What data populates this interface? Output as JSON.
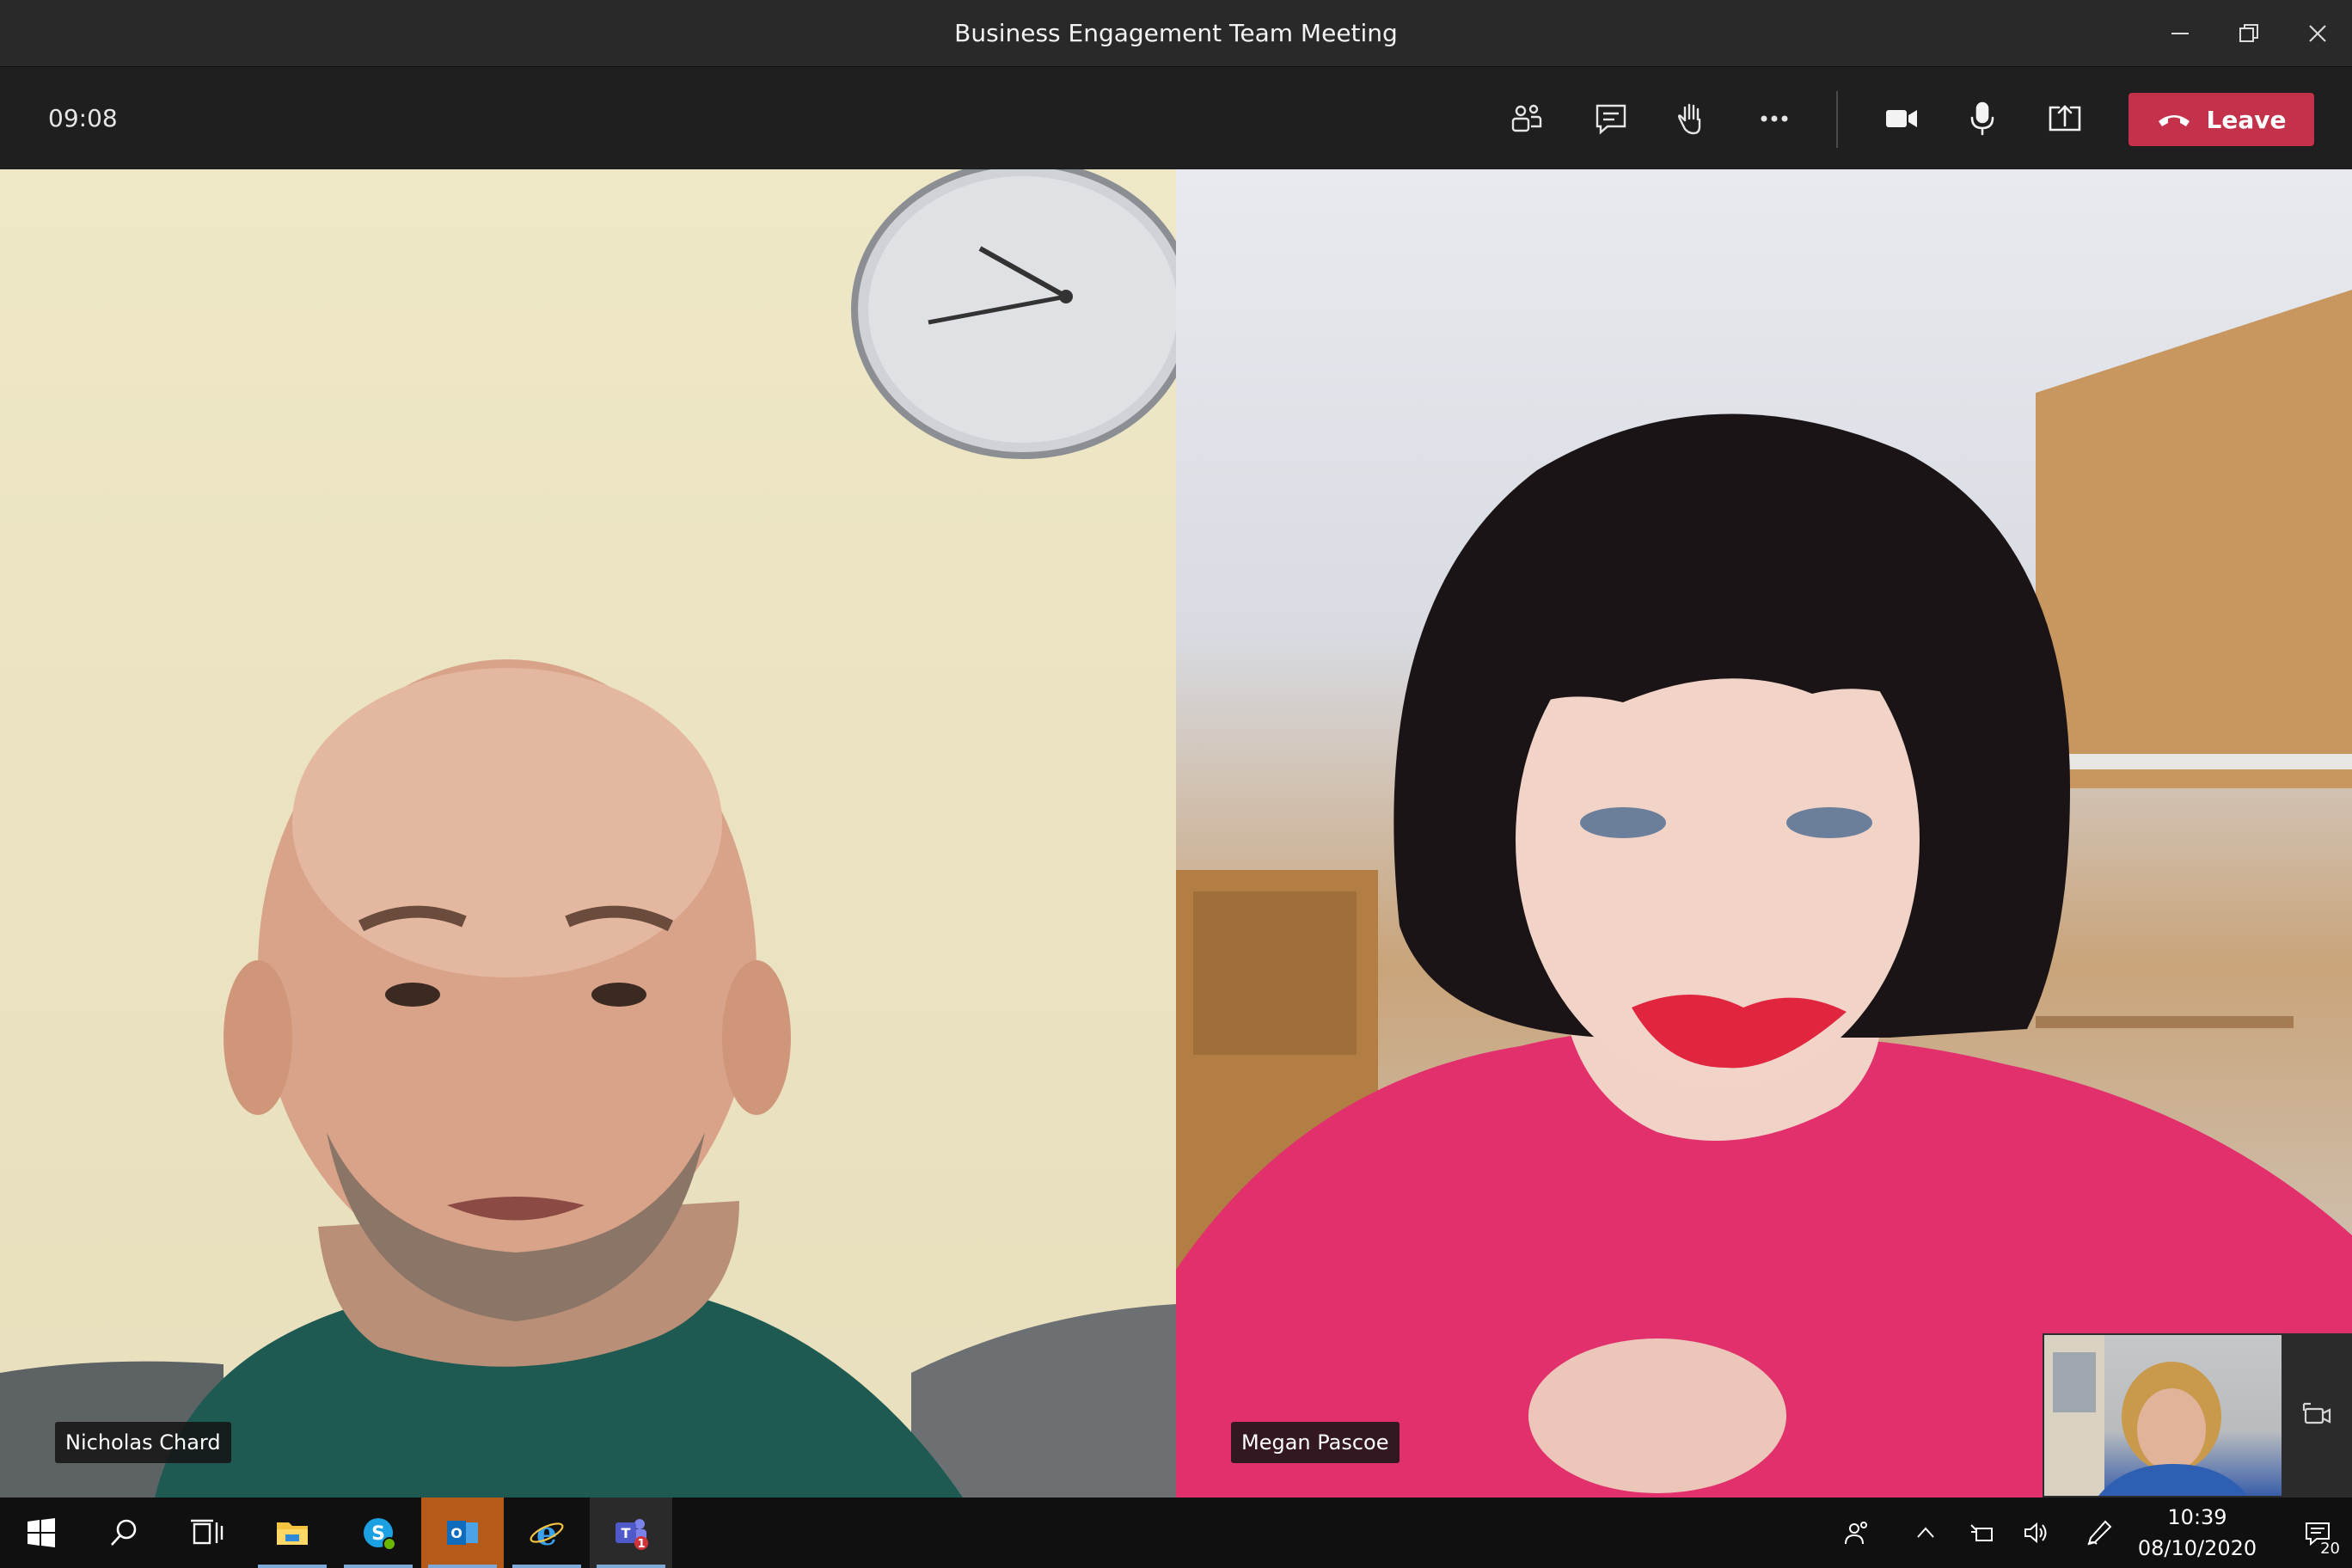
{
  "window": {
    "title": "Business Engagement Team Meeting"
  },
  "toolbar": {
    "timer": "09:08",
    "leave_label": "Leave",
    "icons": [
      "people-icon",
      "chat-icon",
      "raise-hand-icon",
      "more-options-icon",
      "camera-icon",
      "microphone-icon",
      "share-screen-icon",
      "hang-up-icon"
    ]
  },
  "participants": [
    {
      "name": "Nicholas Chard"
    },
    {
      "name": "Megan Pascoe"
    }
  ],
  "taskbar": {
    "apps": [
      "windows-start-icon",
      "search-icon",
      "task-view-icon",
      "file-explorer-icon",
      "skype-icon",
      "outlook-icon",
      "internet-explorer-icon",
      "teams-icon"
    ],
    "teams_badge": "1",
    "time": "10:39",
    "date": "08/10/2020",
    "notification_count": "20"
  },
  "colors": {
    "leave_button": "#c4314b",
    "titlebar": "#292929",
    "toolbar": "#1f1f1f",
    "taskbar": "#101010"
  }
}
